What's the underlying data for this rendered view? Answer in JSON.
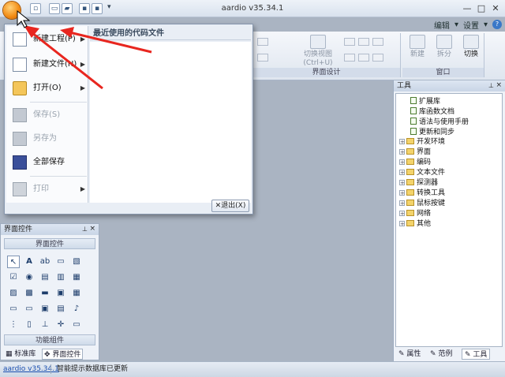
{
  "window": {
    "title": "aardio v35.34.1",
    "minimize": "—",
    "maximize": "□",
    "close": "✕"
  },
  "menubar": {
    "edit": "编辑",
    "settings": "设置"
  },
  "ribbon": {
    "switch_view": "切换视图",
    "switch_view_shortcut": "(Ctrl+U)",
    "group_ui_design": "界面设计",
    "new": "新建",
    "split": "拆分",
    "switch": "切换",
    "group_window": "窗口"
  },
  "app_menu": {
    "items": [
      {
        "label": "新建工程(P)",
        "enabled": true,
        "submenu": true
      },
      {
        "label": "新建文件(N)",
        "enabled": true,
        "submenu": true
      },
      {
        "label": "打开(O)",
        "enabled": true,
        "submenu": true
      },
      {
        "label": "保存(S)",
        "enabled": false,
        "submenu": false
      },
      {
        "label": "另存为",
        "enabled": false,
        "submenu": false
      },
      {
        "label": "全部保存",
        "enabled": true,
        "submenu": false
      },
      {
        "label": "打印",
        "enabled": false,
        "submenu": true
      }
    ],
    "recent_title": "最近使用的代码文件",
    "exit_label": "退出(X)"
  },
  "left_panel": {
    "title": "界面控件",
    "section_controls": "界面控件",
    "section_functions": "功能组件",
    "tabs": [
      "标准库",
      "界面控件"
    ]
  },
  "right_panel": {
    "title": "工具",
    "docs": [
      "扩展库",
      "库函数文档",
      "语法与使用手册",
      "更新和同步"
    ],
    "folders": [
      "开发环境",
      "界面",
      "编码",
      "文本文件",
      "探测器",
      "转换工具",
      "鼠标按键",
      "网络",
      "其他"
    ],
    "tabs": [
      "属性",
      "范例",
      "工具"
    ]
  },
  "statusbar": {
    "version_link": "aardio v35.34.1",
    "message": "智能提示数据库已更新"
  },
  "colors": {
    "annotation_arrow": "#e8261f",
    "orb": "#f28a12"
  }
}
